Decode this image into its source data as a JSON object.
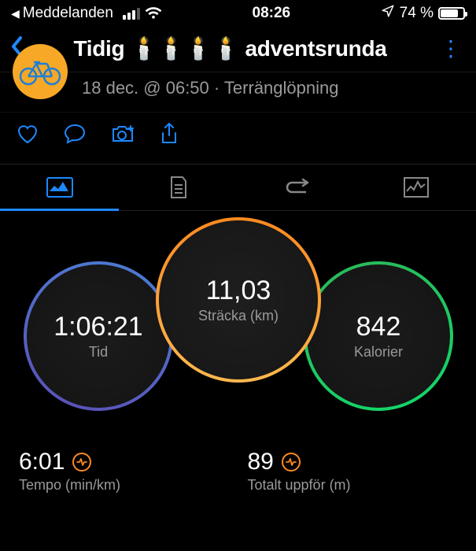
{
  "status": {
    "back_app": "Meddelanden",
    "time": "08:26",
    "battery_pct": "74 %"
  },
  "header": {
    "title": "Tidig 🕯️🕯️🕯️🕯️ adventsrunda"
  },
  "activity": {
    "meta": "18 dec. @ 06:50 · Terränglöpning"
  },
  "circles": {
    "distance": {
      "value": "11,03",
      "label": "Sträcka (km)"
    },
    "time": {
      "value": "1:06:21",
      "label": "Tid"
    },
    "calories": {
      "value": "842",
      "label": "Kalorier"
    }
  },
  "stats": {
    "pace": {
      "value": "6:01",
      "label": "Tempo (min/km)"
    },
    "ascent": {
      "value": "89",
      "label": "Totalt uppför (m)"
    }
  }
}
